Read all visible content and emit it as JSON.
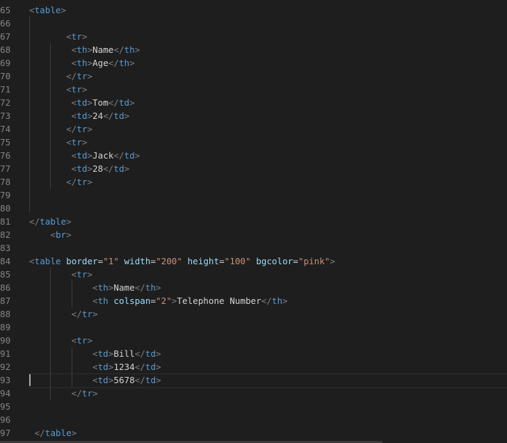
{
  "editor": {
    "lines": [
      {
        "n": "65",
        "indent": 0,
        "t": [
          [
            "punc",
            "<"
          ],
          [
            "tag",
            "table"
          ],
          [
            "punc",
            ">"
          ]
        ]
      },
      {
        "n": "66",
        "indent": 0,
        "t": []
      },
      {
        "n": "67",
        "indent": 0,
        "t": []
      },
      {
        "n": "68",
        "indent": 0,
        "t": []
      },
      {
        "n": "69",
        "indent": 0,
        "t": []
      },
      {
        "n": "70",
        "indent": 0,
        "t": []
      },
      {
        "n": "71",
        "indent": 0,
        "t": []
      },
      {
        "n": "72",
        "indent": 0,
        "t": []
      },
      {
        "n": "73",
        "indent": 0,
        "t": []
      },
      {
        "n": "74",
        "indent": 0,
        "t": []
      },
      {
        "n": "75",
        "indent": 0,
        "t": []
      },
      {
        "n": "76",
        "indent": 0,
        "t": []
      },
      {
        "n": "77",
        "indent": 0,
        "t": []
      },
      {
        "n": "78",
        "indent": 0,
        "t": []
      },
      {
        "n": "79",
        "indent": 0,
        "t": []
      },
      {
        "n": "80",
        "indent": 0,
        "t": []
      },
      {
        "n": "81",
        "indent": 0,
        "t": []
      },
      {
        "n": "82",
        "indent": 0,
        "t": []
      },
      {
        "n": "83",
        "indent": 0,
        "t": []
      },
      {
        "n": "84",
        "indent": 0,
        "t": []
      },
      {
        "n": "85",
        "indent": 0,
        "t": []
      },
      {
        "n": "86",
        "indent": 0,
        "t": []
      },
      {
        "n": "87",
        "indent": 0,
        "t": []
      },
      {
        "n": "88",
        "indent": 0,
        "t": []
      },
      {
        "n": "89",
        "indent": 0,
        "t": []
      },
      {
        "n": "90",
        "indent": 0,
        "t": []
      },
      {
        "n": "91",
        "indent": 0,
        "t": []
      },
      {
        "n": "92",
        "indent": 0,
        "t": []
      },
      {
        "n": "93",
        "indent": 0,
        "t": []
      },
      {
        "n": "94",
        "indent": 0,
        "t": []
      },
      {
        "n": "95",
        "indent": 0,
        "t": []
      },
      {
        "n": "96",
        "indent": 0,
        "t": []
      },
      {
        "n": "97",
        "indent": 0,
        "t": []
      }
    ],
    "code": [
      [
        [
          "punc",
          "<"
        ],
        [
          "tag",
          "table"
        ],
        [
          "punc",
          ">"
        ]
      ],
      [],
      [
        [
          "txt",
          "       "
        ],
        [
          "punc",
          "<"
        ],
        [
          "tag",
          "tr"
        ],
        [
          "punc",
          ">"
        ]
      ],
      [
        [
          "txt",
          "        "
        ],
        [
          "punc",
          "<"
        ],
        [
          "tag",
          "th"
        ],
        [
          "punc",
          ">"
        ],
        [
          "txt",
          "Name"
        ],
        [
          "punc",
          "</"
        ],
        [
          "tag",
          "th"
        ],
        [
          "punc",
          ">"
        ]
      ],
      [
        [
          "txt",
          "        "
        ],
        [
          "punc",
          "<"
        ],
        [
          "tag",
          "th"
        ],
        [
          "punc",
          ">"
        ],
        [
          "txt",
          "Age"
        ],
        [
          "punc",
          "</"
        ],
        [
          "tag",
          "th"
        ],
        [
          "punc",
          ">"
        ]
      ],
      [
        [
          "txt",
          "       "
        ],
        [
          "punc",
          "</"
        ],
        [
          "tag",
          "tr"
        ],
        [
          "punc",
          ">"
        ]
      ],
      [
        [
          "txt",
          "       "
        ],
        [
          "punc",
          "<"
        ],
        [
          "tag",
          "tr"
        ],
        [
          "punc",
          ">"
        ]
      ],
      [
        [
          "txt",
          "        "
        ],
        [
          "punc",
          "<"
        ],
        [
          "tag",
          "td"
        ],
        [
          "punc",
          ">"
        ],
        [
          "txt",
          "Tom"
        ],
        [
          "punc",
          "</"
        ],
        [
          "tag",
          "td"
        ],
        [
          "punc",
          ">"
        ]
      ],
      [
        [
          "txt",
          "        "
        ],
        [
          "punc",
          "<"
        ],
        [
          "tag",
          "td"
        ],
        [
          "punc",
          ">"
        ],
        [
          "txt",
          "24"
        ],
        [
          "punc",
          "</"
        ],
        [
          "tag",
          "td"
        ],
        [
          "punc",
          ">"
        ]
      ],
      [
        [
          "txt",
          "       "
        ],
        [
          "punc",
          "</"
        ],
        [
          "tag",
          "tr"
        ],
        [
          "punc",
          ">"
        ]
      ],
      [
        [
          "txt",
          "       "
        ],
        [
          "punc",
          "<"
        ],
        [
          "tag",
          "tr"
        ],
        [
          "punc",
          ">"
        ]
      ],
      [
        [
          "txt",
          "        "
        ],
        [
          "punc",
          "<"
        ],
        [
          "tag",
          "td"
        ],
        [
          "punc",
          ">"
        ],
        [
          "txt",
          "Jack"
        ],
        [
          "punc",
          "</"
        ],
        [
          "tag",
          "td"
        ],
        [
          "punc",
          ">"
        ]
      ],
      [
        [
          "txt",
          "        "
        ],
        [
          "punc",
          "<"
        ],
        [
          "tag",
          "td"
        ],
        [
          "punc",
          ">"
        ],
        [
          "txt",
          "28"
        ],
        [
          "punc",
          "</"
        ],
        [
          "tag",
          "td"
        ],
        [
          "punc",
          ">"
        ]
      ],
      [
        [
          "txt",
          "       "
        ],
        [
          "punc",
          "</"
        ],
        [
          "tag",
          "tr"
        ],
        [
          "punc",
          ">"
        ]
      ],
      [],
      [],
      [
        [
          "punc",
          "</"
        ],
        [
          "tag",
          "table"
        ],
        [
          "punc",
          ">"
        ]
      ],
      [
        [
          "txt",
          "    "
        ],
        [
          "punc",
          "<"
        ],
        [
          "tag",
          "br"
        ],
        [
          "punc",
          ">"
        ]
      ],
      [],
      [
        [
          "punc",
          "<"
        ],
        [
          "tag",
          "table"
        ],
        [
          "txt",
          " "
        ],
        [
          "attr",
          "border"
        ],
        [
          "txt",
          "="
        ],
        [
          "val",
          "\"1\""
        ],
        [
          "txt",
          " "
        ],
        [
          "attr",
          "width"
        ],
        [
          "txt",
          "="
        ],
        [
          "val",
          "\"200\""
        ],
        [
          "txt",
          " "
        ],
        [
          "attr",
          "height"
        ],
        [
          "txt",
          "="
        ],
        [
          "val",
          "\"100\""
        ],
        [
          "txt",
          " "
        ],
        [
          "attr",
          "bgcolor"
        ],
        [
          "txt",
          "="
        ],
        [
          "val",
          "\"pink\""
        ],
        [
          "punc",
          ">"
        ]
      ],
      [
        [
          "txt",
          "        "
        ],
        [
          "punc",
          "<"
        ],
        [
          "tag",
          "tr"
        ],
        [
          "punc",
          ">"
        ]
      ],
      [
        [
          "txt",
          "            "
        ],
        [
          "punc",
          "<"
        ],
        [
          "tag",
          "th"
        ],
        [
          "punc",
          ">"
        ],
        [
          "txt",
          "Name"
        ],
        [
          "punc",
          "</"
        ],
        [
          "tag",
          "th"
        ],
        [
          "punc",
          ">"
        ]
      ],
      [
        [
          "txt",
          "            "
        ],
        [
          "punc",
          "<"
        ],
        [
          "tag",
          "th"
        ],
        [
          "txt",
          " "
        ],
        [
          "attr",
          "colspan"
        ],
        [
          "txt",
          "="
        ],
        [
          "val",
          "\"2\""
        ],
        [
          "punc",
          ">"
        ],
        [
          "txt",
          "Telephone Number"
        ],
        [
          "punc",
          "</"
        ],
        [
          "tag",
          "th"
        ],
        [
          "punc",
          ">"
        ]
      ],
      [
        [
          "txt",
          "        "
        ],
        [
          "punc",
          "</"
        ],
        [
          "tag",
          "tr"
        ],
        [
          "punc",
          ">"
        ]
      ],
      [],
      [
        [
          "txt",
          "        "
        ],
        [
          "punc",
          "<"
        ],
        [
          "tag",
          "tr"
        ],
        [
          "punc",
          ">"
        ]
      ],
      [
        [
          "txt",
          "            "
        ],
        [
          "punc",
          "<"
        ],
        [
          "tag",
          "td"
        ],
        [
          "punc",
          ">"
        ],
        [
          "txt",
          "Bill"
        ],
        [
          "punc",
          "</"
        ],
        [
          "tag",
          "td"
        ],
        [
          "punc",
          ">"
        ]
      ],
      [
        [
          "txt",
          "            "
        ],
        [
          "punc",
          "<"
        ],
        [
          "tag",
          "td"
        ],
        [
          "punc",
          ">"
        ],
        [
          "txt",
          "1234"
        ],
        [
          "punc",
          "</"
        ],
        [
          "tag",
          "td"
        ],
        [
          "punc",
          ">"
        ]
      ],
      [
        [
          "txt",
          "            "
        ],
        [
          "punc",
          "<"
        ],
        [
          "tag",
          "td"
        ],
        [
          "punc",
          ">"
        ],
        [
          "txt",
          "5678"
        ],
        [
          "punc",
          "</"
        ],
        [
          "tag",
          "td"
        ],
        [
          "punc",
          ">"
        ]
      ],
      [
        [
          "txt",
          "        "
        ],
        [
          "punc",
          "</"
        ],
        [
          "tag",
          "tr"
        ],
        [
          "punc",
          ">"
        ]
      ],
      [],
      [],
      [
        [
          "txt",
          " "
        ],
        [
          "punc",
          "</"
        ],
        [
          "tag",
          "table"
        ],
        [
          "punc",
          ">"
        ]
      ]
    ],
    "current_line": "93"
  }
}
